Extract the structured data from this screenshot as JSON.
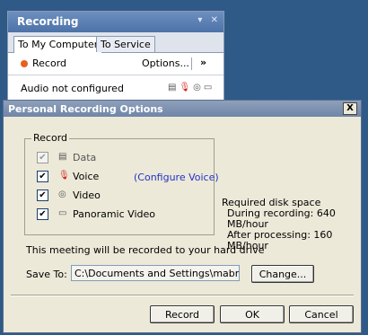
{
  "recording_panel": {
    "title": "Recording",
    "title_controls": [
      "▾",
      "✕"
    ],
    "tabs": [
      {
        "label": "To My Computer",
        "active": true
      },
      {
        "label": "To Service",
        "active": false
      }
    ],
    "record_label": "Record",
    "options_label": "Options...",
    "more_label": "»",
    "audio_status": "Audio not configured",
    "audio_icons": [
      "data-icon",
      "mic-icon",
      "webcam-icon",
      "panoramic-icon"
    ]
  },
  "dialog": {
    "title": "Personal Recording Options",
    "close_label": "X",
    "group_label": "Record",
    "options": [
      {
        "label": "Data",
        "checked": true,
        "disabled": true,
        "icon": "data-icon"
      },
      {
        "label": "Voice",
        "checked": true,
        "disabled": false,
        "icon": "mic-icon"
      },
      {
        "label": "Video",
        "checked": true,
        "disabled": false,
        "icon": "webcam-icon"
      },
      {
        "label": "Panoramic Video",
        "checked": true,
        "disabled": false,
        "icon": "panoramic-icon"
      }
    ],
    "configure_voice_link": "(Configure Voice)",
    "disk_space": {
      "heading": "Required disk space",
      "during": "During recording: 640 MB/hour",
      "after": "After processing: 160 MB/hour"
    },
    "meeting_message": "This meeting will be recorded to your hard drive",
    "save_to_label": "Save To:",
    "save_path": "C:\\Documents and Settings\\mabrams\\My",
    "change_button": "Change...",
    "record_button": "Record",
    "ok_button": "OK",
    "cancel_button": "Cancel"
  },
  "colors": {
    "background": "#2f5a88",
    "record_dot": "#e8601c",
    "mic_red": "#d32020",
    "link_blue": "#2332c8"
  }
}
